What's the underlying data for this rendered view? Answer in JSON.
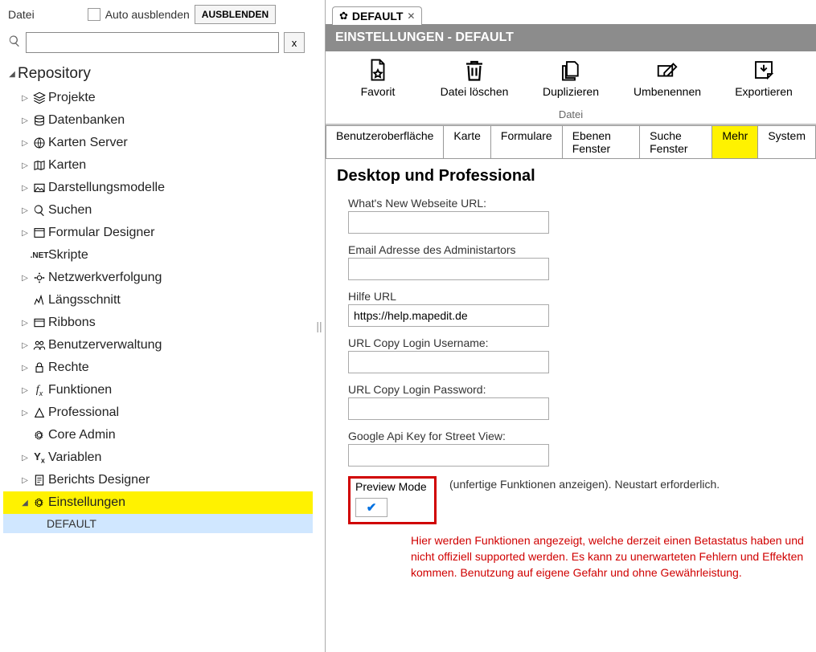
{
  "leftPanel": {
    "fileLabel": "Datei",
    "autoHideLabel": "Auto ausblenden",
    "hideButton": "AUSBLENDEN",
    "searchClear": "x",
    "tree": {
      "root": "Repository",
      "items": [
        {
          "label": "Projekte"
        },
        {
          "label": "Datenbanken"
        },
        {
          "label": "Karten Server"
        },
        {
          "label": "Karten"
        },
        {
          "label": "Darstellungsmodelle"
        },
        {
          "label": "Suchen"
        },
        {
          "label": "Formular Designer"
        },
        {
          "label": "Skripte",
          "noToggle": true
        },
        {
          "label": "Netzwerkverfolgung"
        },
        {
          "label": "Längsschnitt",
          "noToggle": true
        },
        {
          "label": "Ribbons"
        },
        {
          "label": "Benutzerverwaltung"
        },
        {
          "label": "Rechte"
        },
        {
          "label": "Funktionen"
        },
        {
          "label": "Professional"
        },
        {
          "label": "Core Admin",
          "noToggle": true
        },
        {
          "label": "Variablen"
        },
        {
          "label": "Berichts Designer"
        },
        {
          "label": "Einstellungen",
          "highlight": true,
          "expanded": true
        }
      ],
      "leaf": "DEFAULT"
    }
  },
  "rightPanel": {
    "tab": {
      "label": "DEFAULT"
    },
    "banner": "EINSTELLUNGEN - DEFAULT",
    "toolbar": {
      "favorit": "Favorit",
      "loeschen": "Datei löschen",
      "duplizieren": "Duplizieren",
      "umbenennen": "Umbenennen",
      "exportieren": "Exportieren",
      "group": "Datei"
    },
    "subtabs": [
      "Benutzeroberfläche",
      "Karte",
      "Formulare",
      "Ebenen Fenster",
      "Suche Fenster",
      "Mehr",
      "System"
    ],
    "activeSubtab": "Mehr",
    "heading": "Desktop und Professional",
    "fields": {
      "whatsnew": {
        "label": "What's New Webseite URL:",
        "value": ""
      },
      "email": {
        "label": "Email Adresse des Administartors",
        "value": ""
      },
      "help": {
        "label": "Hilfe URL",
        "value": "https://help.mapedit.de"
      },
      "copyuser": {
        "label": "URL Copy Login Username:",
        "value": ""
      },
      "copypass": {
        "label": "URL Copy Login Password:",
        "value": ""
      },
      "gapi": {
        "label": "Google Api Key for Street View:",
        "value": ""
      },
      "preview": {
        "label": "Preview Mode",
        "rest": "(unfertige Funktionen anzeigen). Neustart erforderlich.",
        "checked": true
      },
      "warn": "Hier werden Funktionen angezeigt, welche derzeit einen Betastatus haben und nicht offiziell supported werden. Es kann zu unerwarteten Fehlern und Effekten kommen. Benutzung auf eigene Gefahr und ohne Gewährleistung."
    }
  }
}
